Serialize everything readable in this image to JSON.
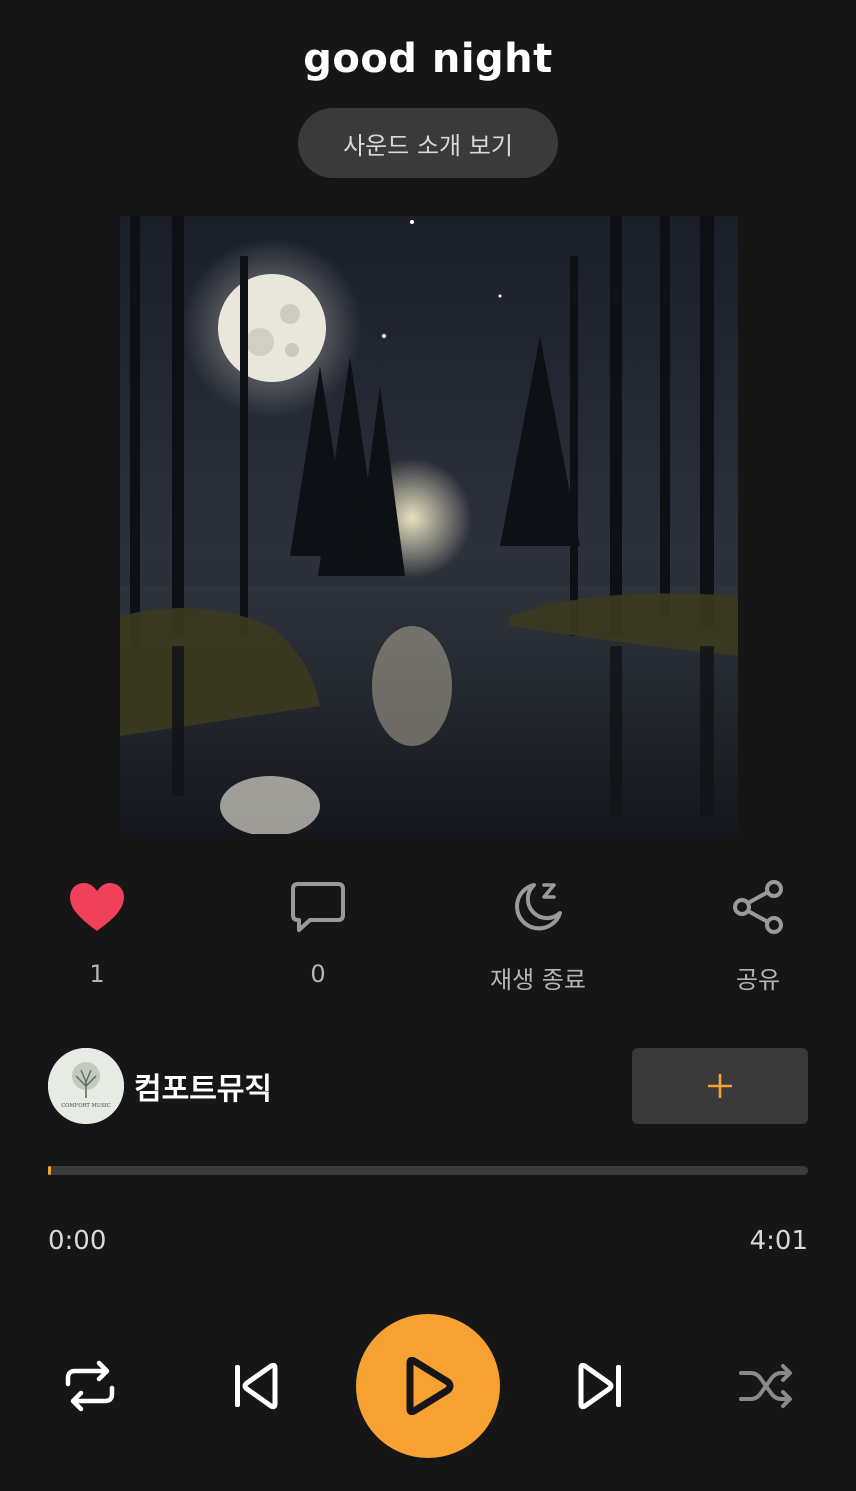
{
  "track": {
    "title": "good night",
    "intro_button_label": "사운드 소개 보기",
    "artwork_icon": "moonlit-forest-lake-image"
  },
  "actions": {
    "like": {
      "icon": "heart-icon",
      "count": "1",
      "color": "#f0405a"
    },
    "comment": {
      "icon": "comment-icon",
      "count": "0"
    },
    "sleep_timer": {
      "icon": "sleep-moon-icon",
      "label": "재생 종료"
    },
    "share": {
      "icon": "share-icon",
      "label": "공유"
    }
  },
  "channel": {
    "name": "컴포트뮤직",
    "avatar_icon": "comfort-music-logo",
    "avatar_text": "COMFORT MUSIC",
    "follow_icon": "plus-icon"
  },
  "player": {
    "progress": 0.004,
    "current_time": "0:00",
    "total_time": "4:01",
    "accent_color": "#f7a133",
    "controls": {
      "repeat_icon": "repeat-icon",
      "prev_icon": "skip-previous-icon",
      "play_icon": "play-icon",
      "next_icon": "skip-next-icon",
      "shuffle_icon": "shuffle-icon"
    }
  }
}
